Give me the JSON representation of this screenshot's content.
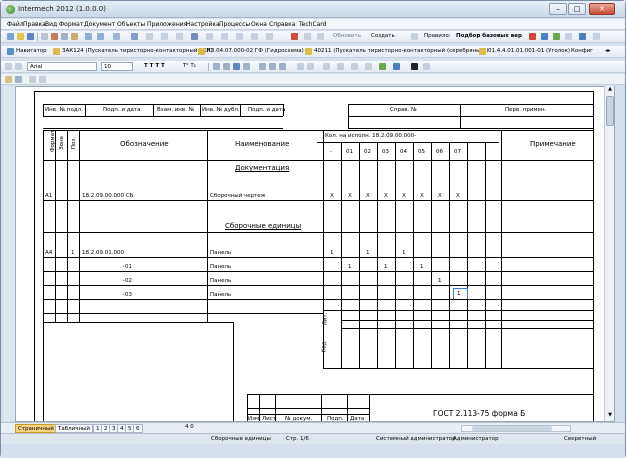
{
  "window": {
    "title": "Intermech 2012 (1.0.0.0)",
    "min_btn": "–",
    "max_btn": "□",
    "close_btn": "✕"
  },
  "menu": [
    "Файл",
    "Правка",
    "Вид",
    "Формат",
    "Документ",
    "Объекты",
    "Приложения",
    "Настройка",
    "Процессы",
    "Окна",
    "Справка",
    "TechCard"
  ],
  "toolbar1": {
    "update_label": "Обновить",
    "create_label": "Создать",
    "rules_label": "Правило:",
    "rules_value": "Подбор базовых вер"
  },
  "toolbar2": {
    "navigator_label": "Навигатор",
    "tabs": [
      "ЗАК124 (Пускатель тиристорно-контакторный ТКП)",
      "КЗ.04.07.000-02 ГФ (Гидросхема)",
      "40211 (Пускатель тиристорно-контакторный (серебряный))",
      "01.4.4.01.01.001-01 (Уголок)",
      "Конфиг"
    ]
  },
  "toolbar3": {
    "font_name": "Arial",
    "font_size": "10"
  },
  "spec": {
    "header_row1": [
      "Инв. № подл.",
      "Подп. и дата",
      "Взам. инв. №",
      "Инв. № дубл.",
      "Подп. и дата",
      "Справ. №",
      "Перв. примен."
    ],
    "col_format": "Формат",
    "col_zone": "Зона",
    "col_pos": "Поз.",
    "col_designation": "Обозначение",
    "col_name": "Наименование",
    "col_qty_header": "Кол. на исполн. 18.2.09.00.000-",
    "col_variants": [
      "-",
      "01",
      "02",
      "03",
      "04",
      "05",
      "06",
      "07"
    ],
    "col_note": "Примечание",
    "section_docs": "Документация",
    "section_assembly": "Сборочные единицы",
    "rows": [
      {
        "format": "А1",
        "zone": "",
        "pos": "",
        "designation": "18.2.09.00.000 СБ",
        "name": "Сборочный чертеж",
        "qty": [
          "X",
          "X",
          "X",
          "X",
          "X",
          "X",
          "X",
          "X"
        ]
      },
      {
        "format": "А4",
        "zone": "",
        "pos": "1",
        "designation": "18.2.09.01.000",
        "name": "Панель",
        "qty": [
          "1",
          "",
          "1",
          "",
          "1",
          "",
          "",
          ""
        ]
      },
      {
        "format": "",
        "zone": "",
        "pos": "",
        "designation": "-01",
        "name": "Панель",
        "qty": [
          "",
          "1",
          "",
          "1",
          "",
          "1",
          "",
          ""
        ]
      },
      {
        "format": "",
        "zone": "",
        "pos": "",
        "designation": "-02",
        "name": "Панель",
        "qty": [
          "",
          "",
          "",
          "",
          "",
          "",
          "1",
          ""
        ]
      },
      {
        "format": "",
        "zone": "",
        "pos": "",
        "designation": "-03",
        "name": "Панель",
        "qty": [
          "",
          "",
          "",
          "",
          "",
          "",
          "",
          "1"
        ]
      }
    ],
    "label_lit": "Лит.",
    "label_kod": "Код",
    "stamp_cols": [
      "Изм",
      "Лист",
      "№ докум.",
      "Подп.",
      "Дата"
    ],
    "stamp_standard": "ГОСТ 2.113-75 форма Б"
  },
  "bottom_tabs": [
    "Страничный",
    "Табличный",
    "1",
    "2",
    "3",
    "4",
    "5",
    "6"
  ],
  "page_counter": "4 0",
  "status": {
    "mode": "Сборочные единицы",
    "page": "Стр. 1/6",
    "user1": "Системный администратор",
    "user2": "Администратор",
    "security": "Секретный"
  }
}
